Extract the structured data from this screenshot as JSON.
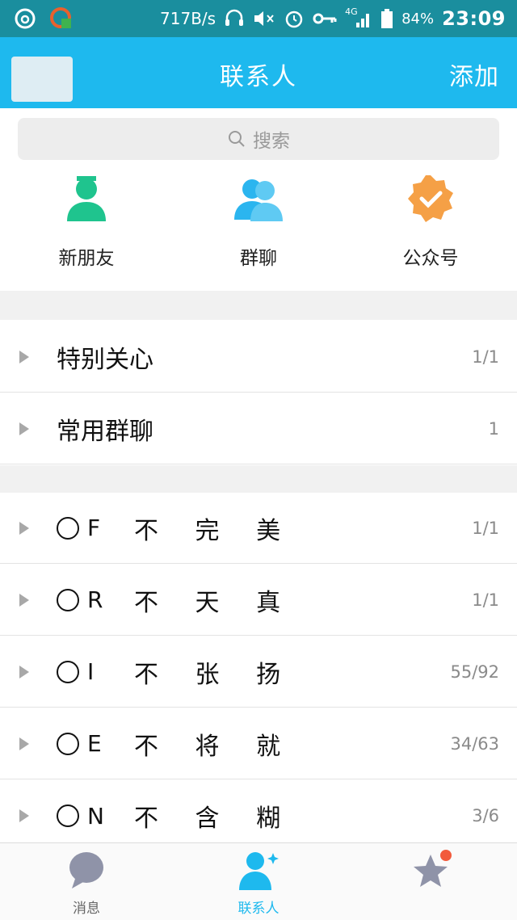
{
  "status_bar": {
    "net_speed": "717B/s",
    "signal": "4G",
    "battery": "84%",
    "time": "23:09"
  },
  "header": {
    "title": "联系人",
    "add_label": "添加"
  },
  "search": {
    "placeholder": "搜索"
  },
  "quick_actions": [
    {
      "label": "新朋友",
      "icon": "new-friend-icon",
      "color": "#1fc48e"
    },
    {
      "label": "群聊",
      "icon": "group-chat-icon",
      "color": "#2bb5ef"
    },
    {
      "label": "公众号",
      "icon": "official-account-icon",
      "color": "#f5a046"
    }
  ],
  "groups_top": [
    {
      "name": "特别关心",
      "count": "1/1"
    },
    {
      "name": "常用群聊",
      "count": "1"
    }
  ],
  "groups": [
    {
      "code": "F",
      "name": "不 完 美",
      "count": "1/1"
    },
    {
      "code": "R",
      "name": "不 天 真",
      "count": "1/1"
    },
    {
      "code": "I",
      "name": "不 张 扬",
      "count": "55/92"
    },
    {
      "code": "E",
      "name": "不 将 就",
      "count": "34/63"
    },
    {
      "code": "N",
      "name": "不 含 糊",
      "count": "3/6"
    }
  ],
  "tabs": [
    {
      "label": "消息",
      "icon": "chat-bubble-icon"
    },
    {
      "label": "联系人",
      "icon": "contacts-icon"
    },
    {
      "label": "",
      "icon": "star-icon"
    }
  ],
  "colors": {
    "status_bar": "#1a8e9e",
    "header": "#1eb9ee",
    "accent": "#1eb9ee"
  }
}
